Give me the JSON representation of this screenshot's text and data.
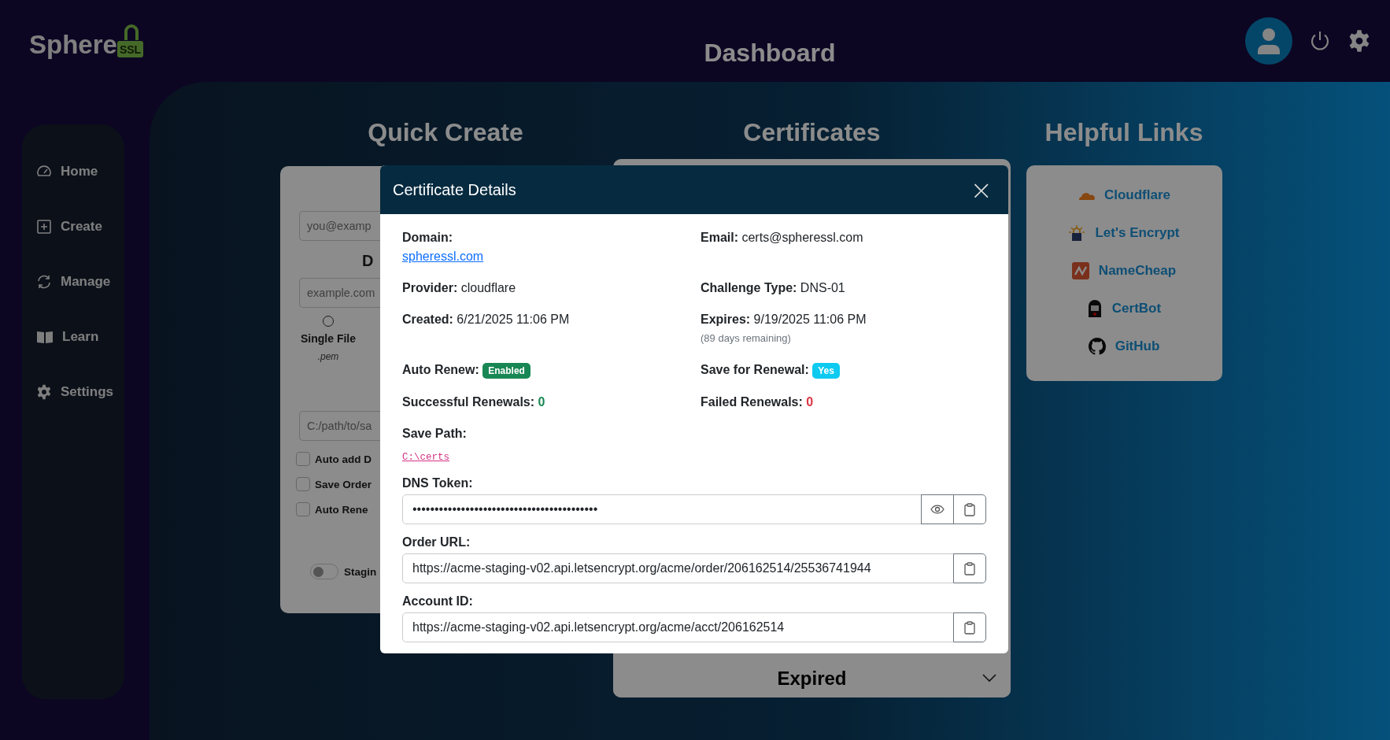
{
  "logo": {
    "text": "Sphere",
    "badge": "SSL"
  },
  "header": {
    "title": "Dashboard"
  },
  "sidebar": {
    "items": [
      {
        "label": "Home",
        "kind": "gauge"
      },
      {
        "label": "Create",
        "kind": "plus"
      },
      {
        "label": "Manage",
        "kind": "sync"
      },
      {
        "label": "Learn",
        "kind": "book"
      },
      {
        "label": "Settings",
        "kind": "gear"
      }
    ]
  },
  "quick_create": {
    "title": "Quick Create",
    "email_placeholder": "you@examp",
    "subheading": "D",
    "domain_placeholder": "example.com",
    "formats": [
      {
        "label": "Single File",
        "note": ".pem",
        "selected": false
      }
    ],
    "path_placeholder": "C:/path/to/sa",
    "options": [
      {
        "label": "Auto add D",
        "checked": false
      },
      {
        "label": "Save Order",
        "checked": false
      },
      {
        "label": "Auto Rene",
        "checked": false
      }
    ],
    "staging": {
      "label": "Stagin",
      "on": false
    }
  },
  "certificates": {
    "title": "Certificates",
    "groups": [
      {
        "label": "Expired",
        "expanded": false
      }
    ]
  },
  "helpful_links": {
    "title": "Helpful Links",
    "links": [
      {
        "label": "Cloudflare",
        "kind": "cloudflare"
      },
      {
        "label": "Let's Encrypt",
        "kind": "letsencrypt"
      },
      {
        "label": "NameCheap",
        "kind": "namecheap"
      },
      {
        "label": "CertBot",
        "kind": "certbot"
      },
      {
        "label": "GitHub",
        "kind": "github"
      }
    ]
  },
  "modal": {
    "title": "Certificate Details",
    "close": "×",
    "details": [
      {
        "label": "Domain:",
        "value": "spheressl.com",
        "kind": "link"
      },
      {
        "label": "Email:",
        "value": "certs@spheressl.com",
        "kind": "text"
      },
      {
        "label": "Provider:",
        "value": "cloudflare",
        "kind": "text"
      },
      {
        "label": "Challenge Type:",
        "value": "DNS-01",
        "kind": "text"
      },
      {
        "label": "Created:",
        "value": "6/21/2025 11:06 PM",
        "kind": "text"
      },
      {
        "label": "Expires:",
        "value": "9/19/2025 11:06 PM",
        "note": "(89 days remaining)",
        "kind": "text"
      },
      {
        "label": "Auto Renew:",
        "value": "Enabled",
        "kind": "badge",
        "color": "#198754"
      },
      {
        "label": "Save for Renewal:",
        "value": "Yes",
        "kind": "badge",
        "color": "#0dcaf0"
      },
      {
        "label": "Successful Renewals:",
        "value": "0",
        "kind": "count",
        "color": "#198754"
      },
      {
        "label": "Failed Renewals:",
        "value": "0",
        "kind": "count",
        "color": "#dc3545"
      },
      {
        "label": "Save Path:",
        "value": "C:\\certs",
        "kind": "code"
      }
    ],
    "fields": [
      {
        "label": "DNS Token:",
        "value": "••••••••••••••••••••••••••••••••••••••••••",
        "kind": "secret"
      },
      {
        "label": "Order URL:",
        "value": "https://acme-staging-v02.api.letsencrypt.org/acme/order/206162514/25536741944",
        "kind": "url"
      },
      {
        "label": "Account ID:",
        "value": "https://acme-staging-v02.api.letsencrypt.org/acme/acct/206162514",
        "kind": "url"
      }
    ]
  }
}
